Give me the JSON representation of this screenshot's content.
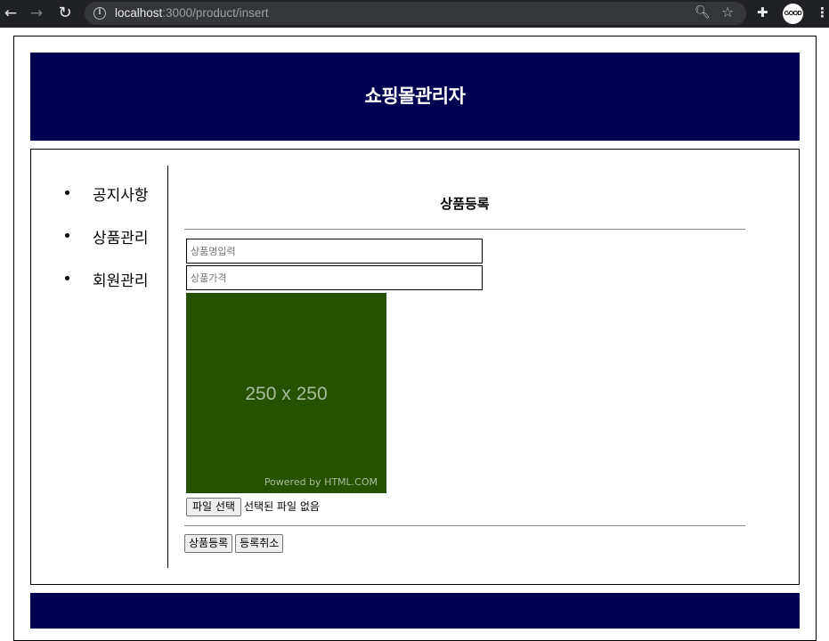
{
  "browser": {
    "url_host": "localhost",
    "url_rest": ":3000/product/insert",
    "avatar_text": "GOOD"
  },
  "header": {
    "title": "쇼핑몰관리자"
  },
  "sidebar": {
    "items": [
      {
        "label": "공지사항"
      },
      {
        "label": "상품관리"
      },
      {
        "label": "회원관리"
      }
    ]
  },
  "form": {
    "title": "상품등록",
    "name_placeholder": "상품명입력",
    "price_placeholder": "상품가격",
    "preview_label": "250 x 250",
    "preview_credit": "Powered by HTML.COM",
    "file_button": "파일 선택",
    "file_status": "선택된 파일 없음",
    "submit_label": "상품등록",
    "cancel_label": "등록취소"
  },
  "colors": {
    "header_bg": "#000050",
    "preview_bg": "#245200"
  }
}
